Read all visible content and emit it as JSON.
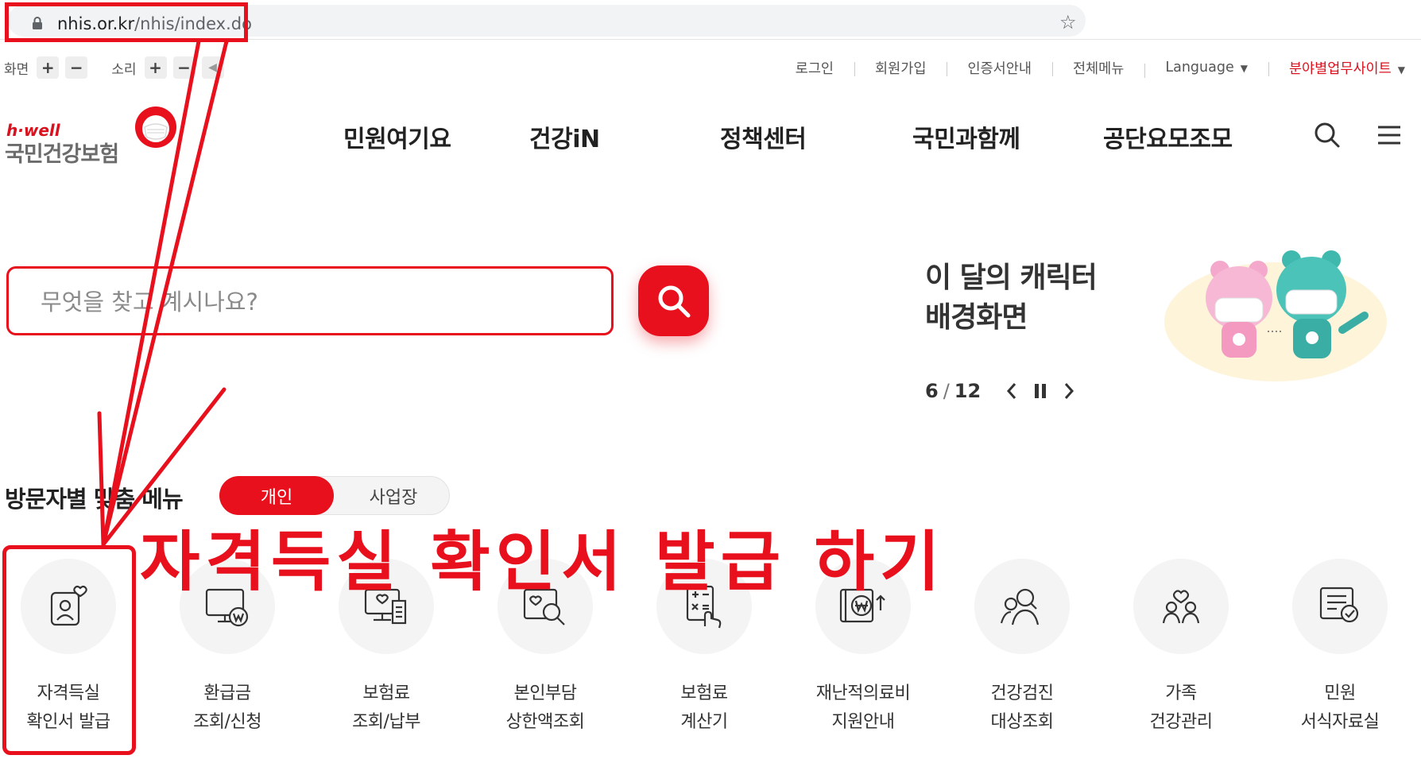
{
  "browser": {
    "url_domain": "nhis.or.kr",
    "url_path": "/nhis/index.do",
    "icons": [
      "lock-icon",
      "star-icon"
    ]
  },
  "utility": {
    "screen_label": "화면",
    "sound_label": "소리",
    "plus": "+",
    "minus": "−",
    "links": [
      "로그인",
      "회원가입",
      "인증서안내",
      "전체메뉴",
      "Language",
      "분야별업무사이트"
    ],
    "accent_link_color": "#d8121e"
  },
  "header": {
    "logo_hwell": "h·well",
    "logo_name": "국민건강보험",
    "nav": [
      "민원여기요",
      "건강iN",
      "정책센터",
      "국민과함께",
      "공단요모조모"
    ],
    "icons": [
      "search-icon",
      "hamburger-menu-icon"
    ]
  },
  "search": {
    "placeholder": "무엇을 찾고 계시나요?"
  },
  "character": {
    "title_line1": "이 달의 캐릭터",
    "title_line2": "배경화면",
    "current_page": "6",
    "page_sep": "/",
    "total_pages": "12"
  },
  "visitor_menu": {
    "title": "방문자별 맞춤 메뉴",
    "toggle_individual": "개인",
    "toggle_business": "사업장"
  },
  "annotation": {
    "text": "자격득실 확인서 발급 하기",
    "color": "#e8101d"
  },
  "quick_menu": [
    {
      "line1": "자격득실",
      "line2": "확인서 발급",
      "icon": "certificate-person-icon"
    },
    {
      "line1": "환급금",
      "line2": "조회/신청",
      "icon": "monitor-refund-icon"
    },
    {
      "line1": "보험료",
      "line2": "조회/납부",
      "icon": "monitor-receipt-icon"
    },
    {
      "line1": "본인부담",
      "line2": "상한액조회",
      "icon": "magnifier-heart-icon"
    },
    {
      "line1": "보험료",
      "line2": "계산기",
      "icon": "calculator-hand-icon"
    },
    {
      "line1": "재난적의료비",
      "line2": "지원안내",
      "icon": "won-support-icon"
    },
    {
      "line1": "건강검진",
      "line2": "대상조회",
      "icon": "people-search-icon"
    },
    {
      "line1": "가족",
      "line2": "건강관리",
      "icon": "family-heart-icon"
    },
    {
      "line1": "민원",
      "line2": "서식자료실",
      "icon": "document-check-icon"
    }
  ]
}
